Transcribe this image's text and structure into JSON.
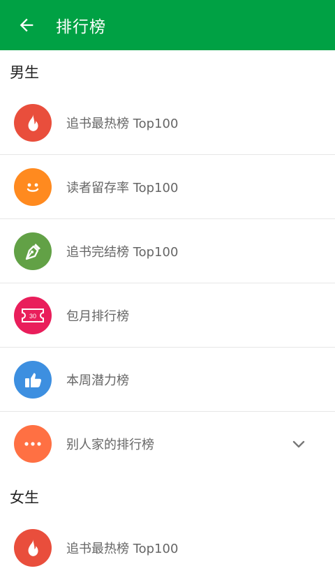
{
  "appbar": {
    "title": "排行榜",
    "back_icon": "arrow-left-icon",
    "color": "#00a144"
  },
  "sections": [
    {
      "header": "男生",
      "items": [
        {
          "label": "追书最热榜 Top100",
          "icon": "flame-icon",
          "color": "#e94e3c"
        },
        {
          "label": "读者留存率 Top100",
          "icon": "smiley-icon",
          "color": "#ff8a1f"
        },
        {
          "label": "追书完结榜 Top100",
          "icon": "pen-nib-icon",
          "color": "#62a146"
        },
        {
          "label": "包月排行榜",
          "icon": "ticket-icon",
          "color": "#e91e5b",
          "ticket_text": "30"
        },
        {
          "label": "本周潜力榜",
          "icon": "thumbs-up-icon",
          "color": "#3d8fe0"
        },
        {
          "label": "别人家的排行榜",
          "icon": "more-dots-icon",
          "color": "#ff7043",
          "expand_icon": "chevron-down-icon"
        }
      ]
    },
    {
      "header": "女生",
      "items": [
        {
          "label": "追书最热榜 Top100",
          "icon": "flame-icon",
          "color": "#e94e3c"
        }
      ]
    }
  ]
}
